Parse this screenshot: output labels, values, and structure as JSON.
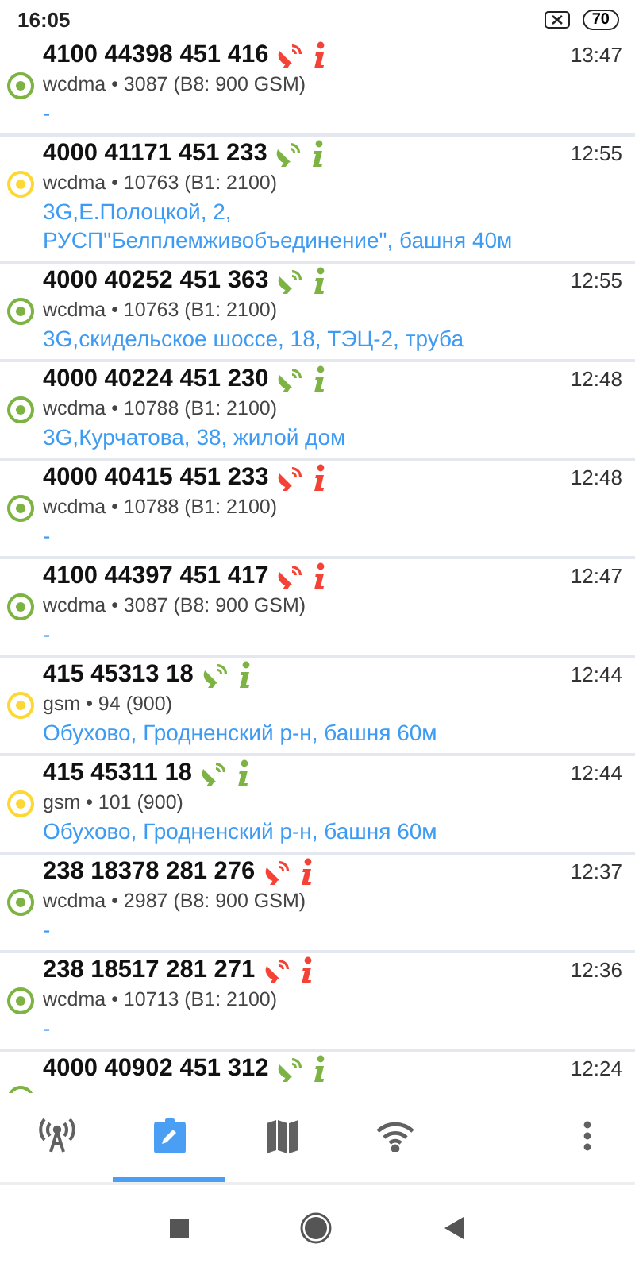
{
  "status_bar": {
    "time": "16:05",
    "battery": "70"
  },
  "cells": [
    {
      "title": "4100 44398 451 416",
      "in_database": false,
      "time": "13:47",
      "color": "#7cb342",
      "info": "wcdma • 3087 (B8: 900 GSM)",
      "address": "-"
    },
    {
      "title": "4000 41171 451 233",
      "in_database": true,
      "time": "12:55",
      "color": "#fdd835",
      "info": "wcdma • 10763 (B1: 2100)",
      "address": "3G,Е.Полоцкой, 2, РУСП\"Белплемживобъединение\", башня 40м"
    },
    {
      "title": "4000 40252 451 363",
      "in_database": true,
      "time": "12:55",
      "color": "#7cb342",
      "info": "wcdma • 10763 (B1: 2100)",
      "address": "3G,скидельское шоссе, 18, ТЭЦ-2, труба"
    },
    {
      "title": "4000 40224 451 230",
      "in_database": true,
      "time": "12:48",
      "color": "#7cb342",
      "info": "wcdma • 10788 (B1: 2100)",
      "address": "3G,Курчатова, 38, жилой дом"
    },
    {
      "title": "4000 40415 451 233",
      "in_database": false,
      "time": "12:48",
      "color": "#7cb342",
      "info": "wcdma • 10788 (B1: 2100)",
      "address": "-"
    },
    {
      "title": "4100 44397 451 417",
      "in_database": false,
      "time": "12:47",
      "color": "#7cb342",
      "info": "wcdma • 3087 (B8: 900 GSM)",
      "address": "-"
    },
    {
      "title": "415 45313 18",
      "in_database": true,
      "time": "12:44",
      "color": "#fdd835",
      "info": "gsm • 94 (900)",
      "address": "Обухово, Гродненский р-н, башня 60м"
    },
    {
      "title": "415 45311 18",
      "in_database": true,
      "time": "12:44",
      "color": "#fdd835",
      "info": "gsm • 101 (900)",
      "address": "Обухово, Гродненский р-н, башня 60м"
    },
    {
      "title": "238 18378 281 276",
      "in_database": false,
      "time": "12:37",
      "color": "#7cb342",
      "info": "wcdma • 2987 (B8: 900 GSM)",
      "address": "-"
    },
    {
      "title": "238 18517 281 271",
      "in_database": false,
      "time": "12:36",
      "color": "#7cb342",
      "info": "wcdma • 10713 (B1: 2100)",
      "address": "-"
    },
    {
      "title": "4000 40902 451 312",
      "in_database": true,
      "time": "12:24",
      "color": "#7cb342"
    }
  ],
  "tabs": [
    {
      "kind": "tower",
      "selected": false
    },
    {
      "kind": "log",
      "selected": true
    },
    {
      "kind": "map",
      "selected": false
    },
    {
      "kind": "wifi",
      "selected": false
    },
    {
      "kind": "more",
      "selected": false
    }
  ]
}
